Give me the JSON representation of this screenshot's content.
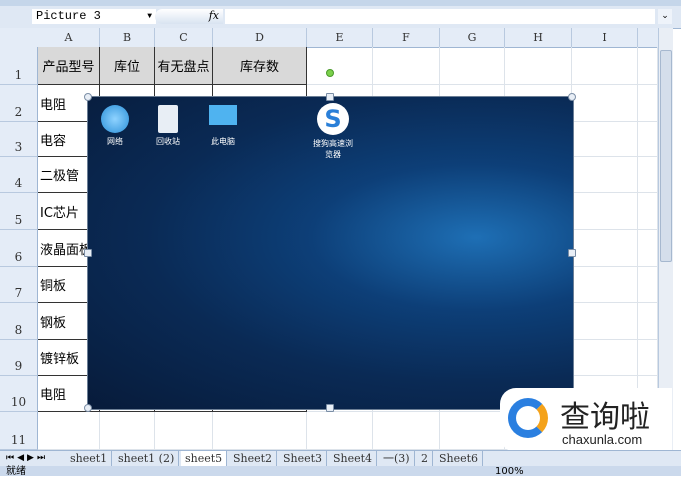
{
  "formula_bar": {
    "name_box": "Picture 3",
    "fx": "fx",
    "formula": ""
  },
  "columns": [
    "A",
    "B",
    "C",
    "D",
    "E",
    "F",
    "G",
    "H",
    "I"
  ],
  "rows": [
    "1",
    "2",
    "3",
    "4",
    "5",
    "6",
    "7",
    "8",
    "9",
    "10",
    "11"
  ],
  "table": {
    "headers": [
      "产品型号",
      "库位",
      "有无盘点",
      "库存数"
    ],
    "col_a": [
      "电阻",
      "电容",
      "二极管",
      "IC芯片",
      "液晶面板",
      "铜板",
      "钢板",
      "镀锌板",
      "电阻"
    ]
  },
  "picture": {
    "desktop_icons": [
      {
        "label": "网络",
        "icon": "network-icon"
      },
      {
        "label": "回收站",
        "icon": "recycle-bin-icon"
      },
      {
        "label": "此电脑",
        "icon": "computer-icon"
      },
      {
        "label": "搜狗高速浏览器",
        "icon": "sogou-browser-icon"
      }
    ]
  },
  "sheet_tabs": [
    "sheet1",
    "sheet1 (2)",
    "sheet5",
    "Sheet2",
    "Sheet3",
    "Sheet4",
    "一(3)",
    "2",
    "Sheet6"
  ],
  "active_sheet": "sheet5",
  "status": {
    "text": "就绪",
    "zoom": "100%"
  },
  "watermark": {
    "brand": "查询啦",
    "domain": "chaxunla.com"
  },
  "colors": {
    "accent": "#1e6fb5",
    "ribbon": "#c5d6ea",
    "header_fill": "#d9d9d9"
  }
}
